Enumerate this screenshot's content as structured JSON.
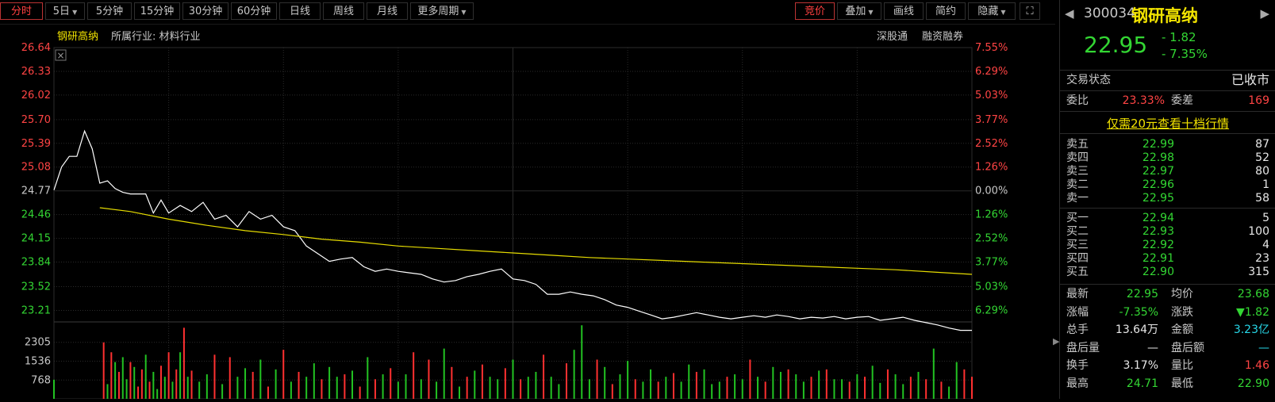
{
  "toolbar": {
    "left": [
      {
        "label": "分时",
        "active": true
      },
      {
        "label": "5日",
        "dropdown": true
      },
      {
        "label": "5分钟"
      },
      {
        "label": "15分钟"
      },
      {
        "label": "30分钟"
      },
      {
        "label": "60分钟"
      },
      {
        "label": "日线"
      },
      {
        "label": "周线"
      },
      {
        "label": "月线"
      },
      {
        "label": "更多周期",
        "dropdown": true
      }
    ],
    "right": [
      {
        "label": "竞价",
        "active": true
      },
      {
        "label": "叠加",
        "dropdown": true
      },
      {
        "label": "画线"
      },
      {
        "label": "简约"
      },
      {
        "label": "隐藏",
        "dropdown": true
      }
    ],
    "expand_icon": "expand-icon"
  },
  "chart_header": {
    "stock_name": "钢研高纳",
    "industry": "所属行业: 材料行业",
    "tag1": "深股通",
    "tag2": "融资融券"
  },
  "chart_data": {
    "type": "line",
    "title": "钢研高纳",
    "prev_close": 24.77,
    "y_ticks_left": [
      "26.64",
      "26.33",
      "26.02",
      "25.70",
      "25.39",
      "25.08",
      "24.77",
      "24.46",
      "24.15",
      "23.84",
      "23.52",
      "23.21"
    ],
    "y_ticks_right": [
      "7.55%",
      "6.29%",
      "5.03%",
      "3.77%",
      "2.52%",
      "1.26%",
      "0.00%",
      "1.26%",
      "2.52%",
      "3.77%",
      "5.03%",
      "6.29%"
    ],
    "ylim": [
      23.08,
      26.64
    ],
    "x": {
      "start": 0,
      "end": 240,
      "unit": "minute"
    },
    "series": [
      {
        "name": "price",
        "color": "#ffffff",
        "x": [
          0,
          2,
          4,
          6,
          8,
          10,
          12,
          14,
          16,
          18,
          20,
          22,
          24,
          26,
          28,
          30,
          33,
          36,
          39,
          42,
          45,
          48,
          51,
          54,
          57,
          60,
          63,
          66,
          69,
          72,
          75,
          78,
          81,
          84,
          87,
          90,
          93,
          96,
          99,
          102,
          105,
          108,
          111,
          114,
          117,
          120,
          123,
          126,
          129,
          132,
          135,
          138,
          141,
          144,
          147,
          150,
          153,
          156,
          159,
          162,
          165,
          168,
          171,
          174,
          177,
          180,
          183,
          186,
          189,
          192,
          195,
          198,
          201,
          204,
          207,
          210,
          213,
          216,
          219,
          222,
          225,
          228,
          231,
          234,
          237,
          240
        ],
        "y": [
          24.78,
          25.08,
          25.22,
          25.22,
          25.55,
          25.32,
          24.87,
          24.9,
          24.8,
          24.75,
          24.73,
          24.73,
          24.73,
          24.48,
          24.65,
          24.48,
          24.58,
          24.5,
          24.62,
          24.4,
          24.45,
          24.3,
          24.5,
          24.4,
          24.45,
          24.3,
          24.25,
          24.05,
          23.95,
          23.85,
          23.88,
          23.9,
          23.78,
          23.72,
          23.75,
          23.72,
          23.7,
          23.68,
          23.62,
          23.58,
          23.6,
          23.65,
          23.68,
          23.72,
          23.75,
          23.62,
          23.6,
          23.55,
          23.42,
          23.42,
          23.45,
          23.42,
          23.4,
          23.35,
          23.28,
          23.25,
          23.2,
          23.15,
          23.1,
          23.12,
          23.15,
          23.18,
          23.15,
          23.12,
          23.1,
          23.12,
          23.14,
          23.12,
          23.15,
          23.13,
          23.1,
          23.12,
          23.11,
          23.13,
          23.1,
          23.12,
          23.13,
          23.08,
          23.1,
          23.12,
          23.08,
          23.05,
          23.02,
          22.98,
          22.95,
          22.95
        ]
      },
      {
        "name": "avg",
        "color": "#e6dc00",
        "x": [
          12,
          20,
          30,
          40,
          50,
          60,
          70,
          80,
          90,
          100,
          110,
          120,
          130,
          140,
          150,
          160,
          170,
          180,
          190,
          200,
          210,
          220,
          230,
          240
        ],
        "y": [
          24.55,
          24.5,
          24.4,
          24.32,
          24.25,
          24.2,
          24.14,
          24.1,
          24.05,
          24.02,
          23.99,
          23.96,
          23.93,
          23.9,
          23.88,
          23.86,
          23.84,
          23.82,
          23.8,
          23.78,
          23.76,
          23.74,
          23.71,
          23.68
        ]
      }
    ],
    "volume": {
      "y_ticks": [
        "2305",
        "1536",
        "768"
      ],
      "ymax": 3073,
      "x": [
        0,
        13,
        14,
        15,
        16,
        17,
        18,
        19,
        20,
        21,
        22,
        23,
        24,
        25,
        26,
        27,
        28,
        29,
        30,
        31,
        32,
        33,
        34,
        35,
        36,
        38,
        40,
        42,
        44,
        46,
        48,
        50,
        52,
        54,
        56,
        58,
        60,
        62,
        64,
        66,
        68,
        70,
        72,
        74,
        76,
        78,
        80,
        82,
        84,
        86,
        88,
        90,
        92,
        94,
        96,
        98,
        100,
        102,
        104,
        106,
        108,
        110,
        112,
        114,
        116,
        118,
        120,
        122,
        124,
        126,
        128,
        130,
        132,
        134,
        136,
        138,
        140,
        142,
        144,
        146,
        148,
        150,
        152,
        154,
        156,
        158,
        160,
        162,
        164,
        166,
        168,
        170,
        172,
        174,
        176,
        178,
        180,
        182,
        184,
        186,
        188,
        190,
        192,
        194,
        196,
        198,
        200,
        202,
        204,
        206,
        208,
        210,
        212,
        214,
        216,
        218,
        220,
        222,
        224,
        226,
        228,
        230,
        232,
        234,
        236,
        238,
        240
      ],
      "values": [
        780,
        2300,
        600,
        1900,
        1500,
        1100,
        1700,
        800,
        1500,
        1300,
        500,
        1200,
        1800,
        700,
        1100,
        400,
        1350,
        900,
        1900,
        700,
        1200,
        1900,
        2900,
        900,
        1150,
        700,
        1000,
        1800,
        600,
        1700,
        900,
        1250,
        1100,
        1600,
        500,
        1200,
        2000,
        700,
        1100,
        900,
        1450,
        800,
        1300,
        900,
        1000,
        1150,
        500,
        1700,
        800,
        1000,
        1250,
        700,
        1000,
        1900,
        800,
        1600,
        700,
        2050,
        1300,
        500,
        900,
        1150,
        1400,
        900,
        800,
        1250,
        1600,
        800,
        900,
        1100,
        1800,
        900,
        600,
        1450,
        2000,
        3000,
        800,
        1600,
        1300,
        600,
        1000,
        1550,
        800,
        700,
        1200,
        700,
        900,
        1050,
        700,
        1400,
        1100,
        1200,
        600,
        700,
        900,
        1000,
        800,
        1600,
        900,
        700,
        1300,
        1100,
        1200,
        1000,
        700,
        900,
        1150,
        1200,
        800,
        800,
        700,
        1000,
        900,
        1350,
        650,
        1200,
        1000,
        600,
        900,
        1100,
        800,
        2050,
        700,
        500,
        1500,
        1200,
        900
      ],
      "colors": [
        "g",
        "r",
        "g",
        "r",
        "g",
        "r",
        "g",
        "g",
        "r",
        "g",
        "r",
        "r",
        "g",
        "r",
        "g",
        "g",
        "r",
        "g",
        "r",
        "g",
        "r",
        "g",
        "r",
        "g",
        "r",
        "g",
        "g",
        "r",
        "g",
        "r",
        "g",
        "g",
        "r",
        "g",
        "r",
        "g",
        "r",
        "g",
        "r",
        "g",
        "g",
        "r",
        "g",
        "g",
        "r",
        "g",
        "r",
        "g",
        "r",
        "g",
        "r",
        "g",
        "g",
        "r",
        "g",
        "r",
        "g",
        "g",
        "r",
        "g",
        "r",
        "g",
        "r",
        "g",
        "g",
        "r",
        "g",
        "r",
        "g",
        "g",
        "r",
        "g",
        "g",
        "r",
        "g",
        "g",
        "g",
        "r",
        "g",
        "r",
        "g",
        "g",
        "r",
        "g",
        "g",
        "r",
        "g",
        "r",
        "g",
        "g",
        "r",
        "g",
        "g",
        "g",
        "r",
        "g",
        "g",
        "r",
        "g",
        "r",
        "g",
        "g",
        "r",
        "g",
        "g",
        "r",
        "g",
        "r",
        "g",
        "g",
        "r",
        "g",
        "r",
        "g",
        "g",
        "r",
        "g",
        "g",
        "r",
        "g",
        "r",
        "g",
        "r",
        "g",
        "g",
        "r",
        "r"
      ]
    },
    "colors": {
      "up": "#ff3030",
      "down": "#22c322",
      "price": "#ffffff",
      "avg": "#e6dc00",
      "grid": "#2b2b2b"
    }
  },
  "quote": {
    "code": "300034",
    "name": "钢研高纳",
    "price": "22.95",
    "change": "- 1.82",
    "change_pct": "- 7.35%",
    "trade_status_label": "交易状态",
    "trade_status": "已收市",
    "ratio_label": "委比",
    "ratio": "23.33%",
    "diff_label": "委差",
    "diff": "169",
    "promo": "仅需20元查看十档行情",
    "sells": [
      {
        "label": "卖五",
        "price": "22.99",
        "vol": "87"
      },
      {
        "label": "卖四",
        "price": "22.98",
        "vol": "52"
      },
      {
        "label": "卖三",
        "price": "22.97",
        "vol": "80"
      },
      {
        "label": "卖二",
        "price": "22.96",
        "vol": "1"
      },
      {
        "label": "卖一",
        "price": "22.95",
        "vol": "58"
      }
    ],
    "buys": [
      {
        "label": "买一",
        "price": "22.94",
        "vol": "5"
      },
      {
        "label": "买二",
        "price": "22.93",
        "vol": "100"
      },
      {
        "label": "买三",
        "price": "22.92",
        "vol": "4"
      },
      {
        "label": "买四",
        "price": "22.91",
        "vol": "23"
      },
      {
        "label": "买五",
        "price": "22.90",
        "vol": "315"
      }
    ],
    "stats": [
      {
        "l1": "最新",
        "v1": "22.95",
        "c1": "green",
        "l2": "均价",
        "v2": "23.68",
        "c2": "green"
      },
      {
        "l1": "涨幅",
        "v1": "-7.35%",
        "c1": "green",
        "l2": "涨跌",
        "v2": "▼1.82",
        "c2": "green"
      },
      {
        "l1": "总手",
        "v1": "13.64万",
        "c1": "white",
        "l2": "金额",
        "v2": "3.23亿",
        "c2": "cyan"
      },
      {
        "l1": "盘后量",
        "v1": "—",
        "c1": "white",
        "l2": "盘后额",
        "v2": "—",
        "c2": "cyan"
      },
      {
        "l1": "换手",
        "v1": "3.17%",
        "c1": "white",
        "l2": "量比",
        "v2": "1.46",
        "c2": "red"
      },
      {
        "l1": "最高",
        "v1": "24.71",
        "c1": "green",
        "l2": "最低",
        "v2": "22.90",
        "c2": "green"
      }
    ]
  }
}
